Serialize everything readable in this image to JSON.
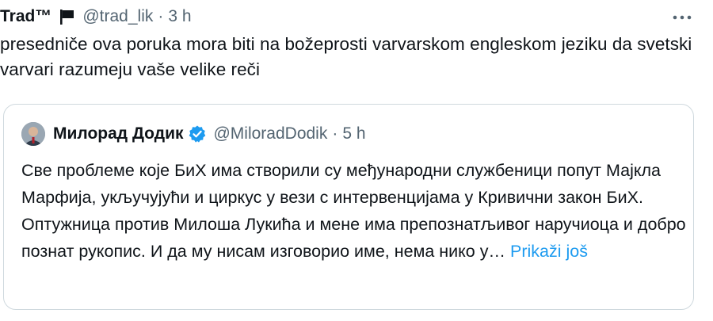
{
  "tweet": {
    "author_name": "Trad™",
    "flag_icon": "black-flag-icon",
    "handle": "@trad_lik",
    "separator": "·",
    "time": "3 h",
    "more_icon": "more-horizontal-icon",
    "text": "presedniče ova poruka mora biti na božeprosti varvarskom engleskom jeziku da svetski varvari razumeju vaše velike reči"
  },
  "quote": {
    "avatar_icon": "profile-avatar",
    "author_name": "Милорад Додик",
    "verified_icon": "verified-badge-icon",
    "verified_color": "#1d9bf0",
    "handle": "@MiloradDodik",
    "separator": "·",
    "time": "5 h",
    "text": "Све проблеме које БиХ има створили су међународни службеници попут Мајкла Марфија, укључујући и циркус у вези с интервенцијама у Кривични закон БиХ. Оптужница против Милоша Лукића и мене има препознатљивог наручиоца и добро познат рукопис. И да му нисам изговорио име, нема нико у…",
    "show_more": "Prikaži još"
  },
  "colors": {
    "text_primary": "#0f1419",
    "text_secondary": "#536471",
    "link": "#1d9bf0",
    "border": "#cfd9de"
  }
}
